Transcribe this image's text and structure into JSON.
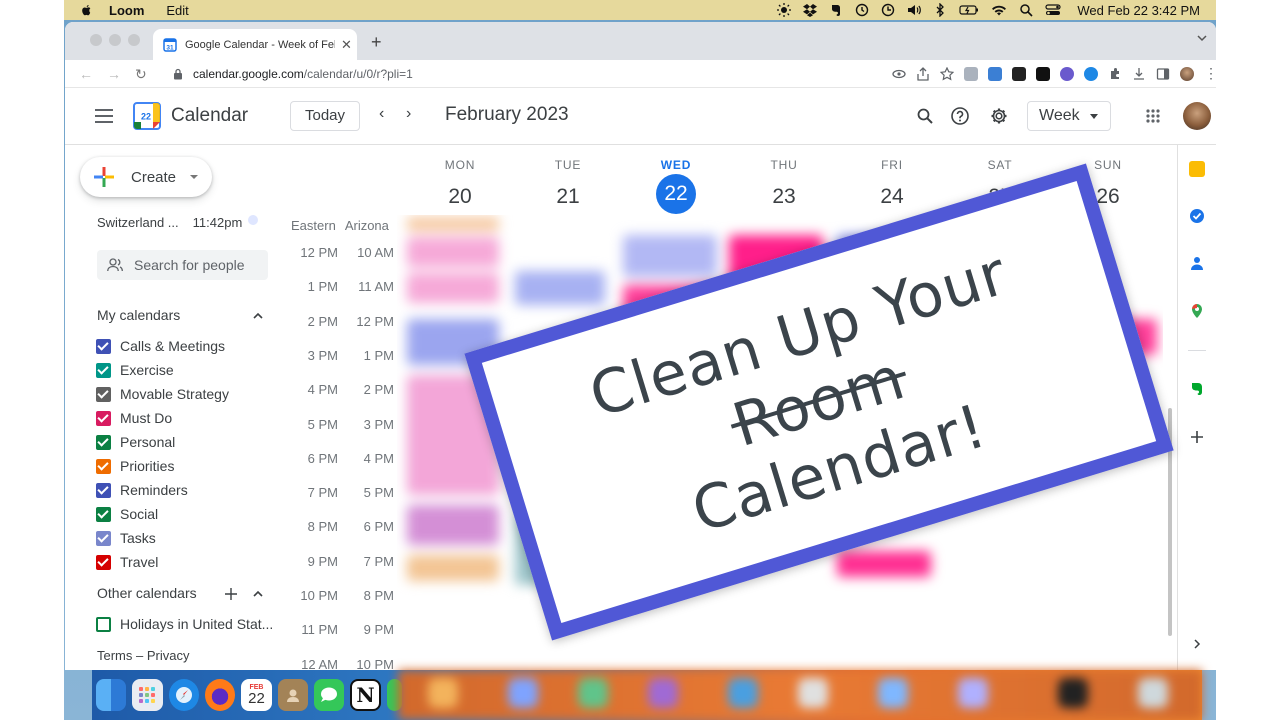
{
  "menubar": {
    "app_name": "Loom",
    "menu_edit": "Edit",
    "clock": "Wed Feb 22  3:42 PM"
  },
  "browser": {
    "tab_title": "Google Calendar - Week of Fel",
    "url_host": "calendar.google.com",
    "url_path": "/calendar/u/0/r?pli=1"
  },
  "header": {
    "app_title": "Calendar",
    "logo_day": "22",
    "today_label": "Today",
    "prev_label": "‹",
    "next_label": "›",
    "month_title": "February 2023",
    "view_label": "Week"
  },
  "sidebar": {
    "create_label": "Create",
    "world_clock": {
      "place": "Switzerland ...",
      "time": "11:42pm"
    },
    "people_search_placeholder": "Search for people",
    "my_calendars_title": "My calendars",
    "my_calendars": [
      {
        "label": "Calls & Meetings",
        "color": "#3f51b5"
      },
      {
        "label": "Exercise",
        "color": "#009688"
      },
      {
        "label": "Movable Strategy",
        "color": "#616161"
      },
      {
        "label": "Must Do",
        "color": "#d81b60"
      },
      {
        "label": "Personal",
        "color": "#0b8043"
      },
      {
        "label": "Priorities",
        "color": "#ef6c00"
      },
      {
        "label": "Reminders",
        "color": "#3f51b5"
      },
      {
        "label": "Social",
        "color": "#0b8043"
      },
      {
        "label": "Tasks",
        "color": "#7986cb"
      },
      {
        "label": "Travel",
        "color": "#d50000"
      }
    ],
    "other_calendars_title": "Other calendars",
    "other_calendars": [
      {
        "label": "Holidays in United Stat...",
        "color": "#0b8043",
        "checked": false
      }
    ],
    "footer": "Terms – Privacy"
  },
  "timezones": {
    "primary": "Eastern",
    "secondary": "Arizona"
  },
  "time_rows": [
    {
      "eastern": "12 PM",
      "arizona": "10 AM"
    },
    {
      "eastern": "1 PM",
      "arizona": "11 AM"
    },
    {
      "eastern": "2 PM",
      "arizona": "12 PM"
    },
    {
      "eastern": "3 PM",
      "arizona": "1 PM"
    },
    {
      "eastern": "4 PM",
      "arizona": "2 PM"
    },
    {
      "eastern": "5 PM",
      "arizona": "3 PM"
    },
    {
      "eastern": "6 PM",
      "arizona": "4 PM"
    },
    {
      "eastern": "7 PM",
      "arizona": "5 PM"
    },
    {
      "eastern": "8 PM",
      "arizona": "6 PM"
    },
    {
      "eastern": "9 PM",
      "arizona": "7 PM"
    },
    {
      "eastern": "10 PM",
      "arizona": "8 PM"
    },
    {
      "eastern": "11 PM",
      "arizona": "9 PM"
    },
    {
      "eastern": "12 AM",
      "arizona": "10 PM"
    }
  ],
  "days": [
    {
      "name": "MON",
      "num": "20",
      "today": false
    },
    {
      "name": "TUE",
      "num": "21",
      "today": false
    },
    {
      "name": "WED",
      "num": "22",
      "today": true
    },
    {
      "name": "THU",
      "num": "23",
      "today": false
    },
    {
      "name": "FRI",
      "num": "24",
      "today": false
    },
    {
      "name": "SAT",
      "num": "25",
      "today": false
    },
    {
      "name": "SUN",
      "num": "26",
      "today": false
    }
  ],
  "overlay": {
    "line1": "Clean Up Your",
    "line2_struck": "Room",
    "line3": "Calendar!"
  },
  "dock": {
    "calendar_month": "FEB",
    "calendar_day": "22"
  },
  "colors": {
    "accent": "#1a73e8",
    "sign_border": "#5058d6",
    "menubar_bg": "#e6d99c"
  }
}
